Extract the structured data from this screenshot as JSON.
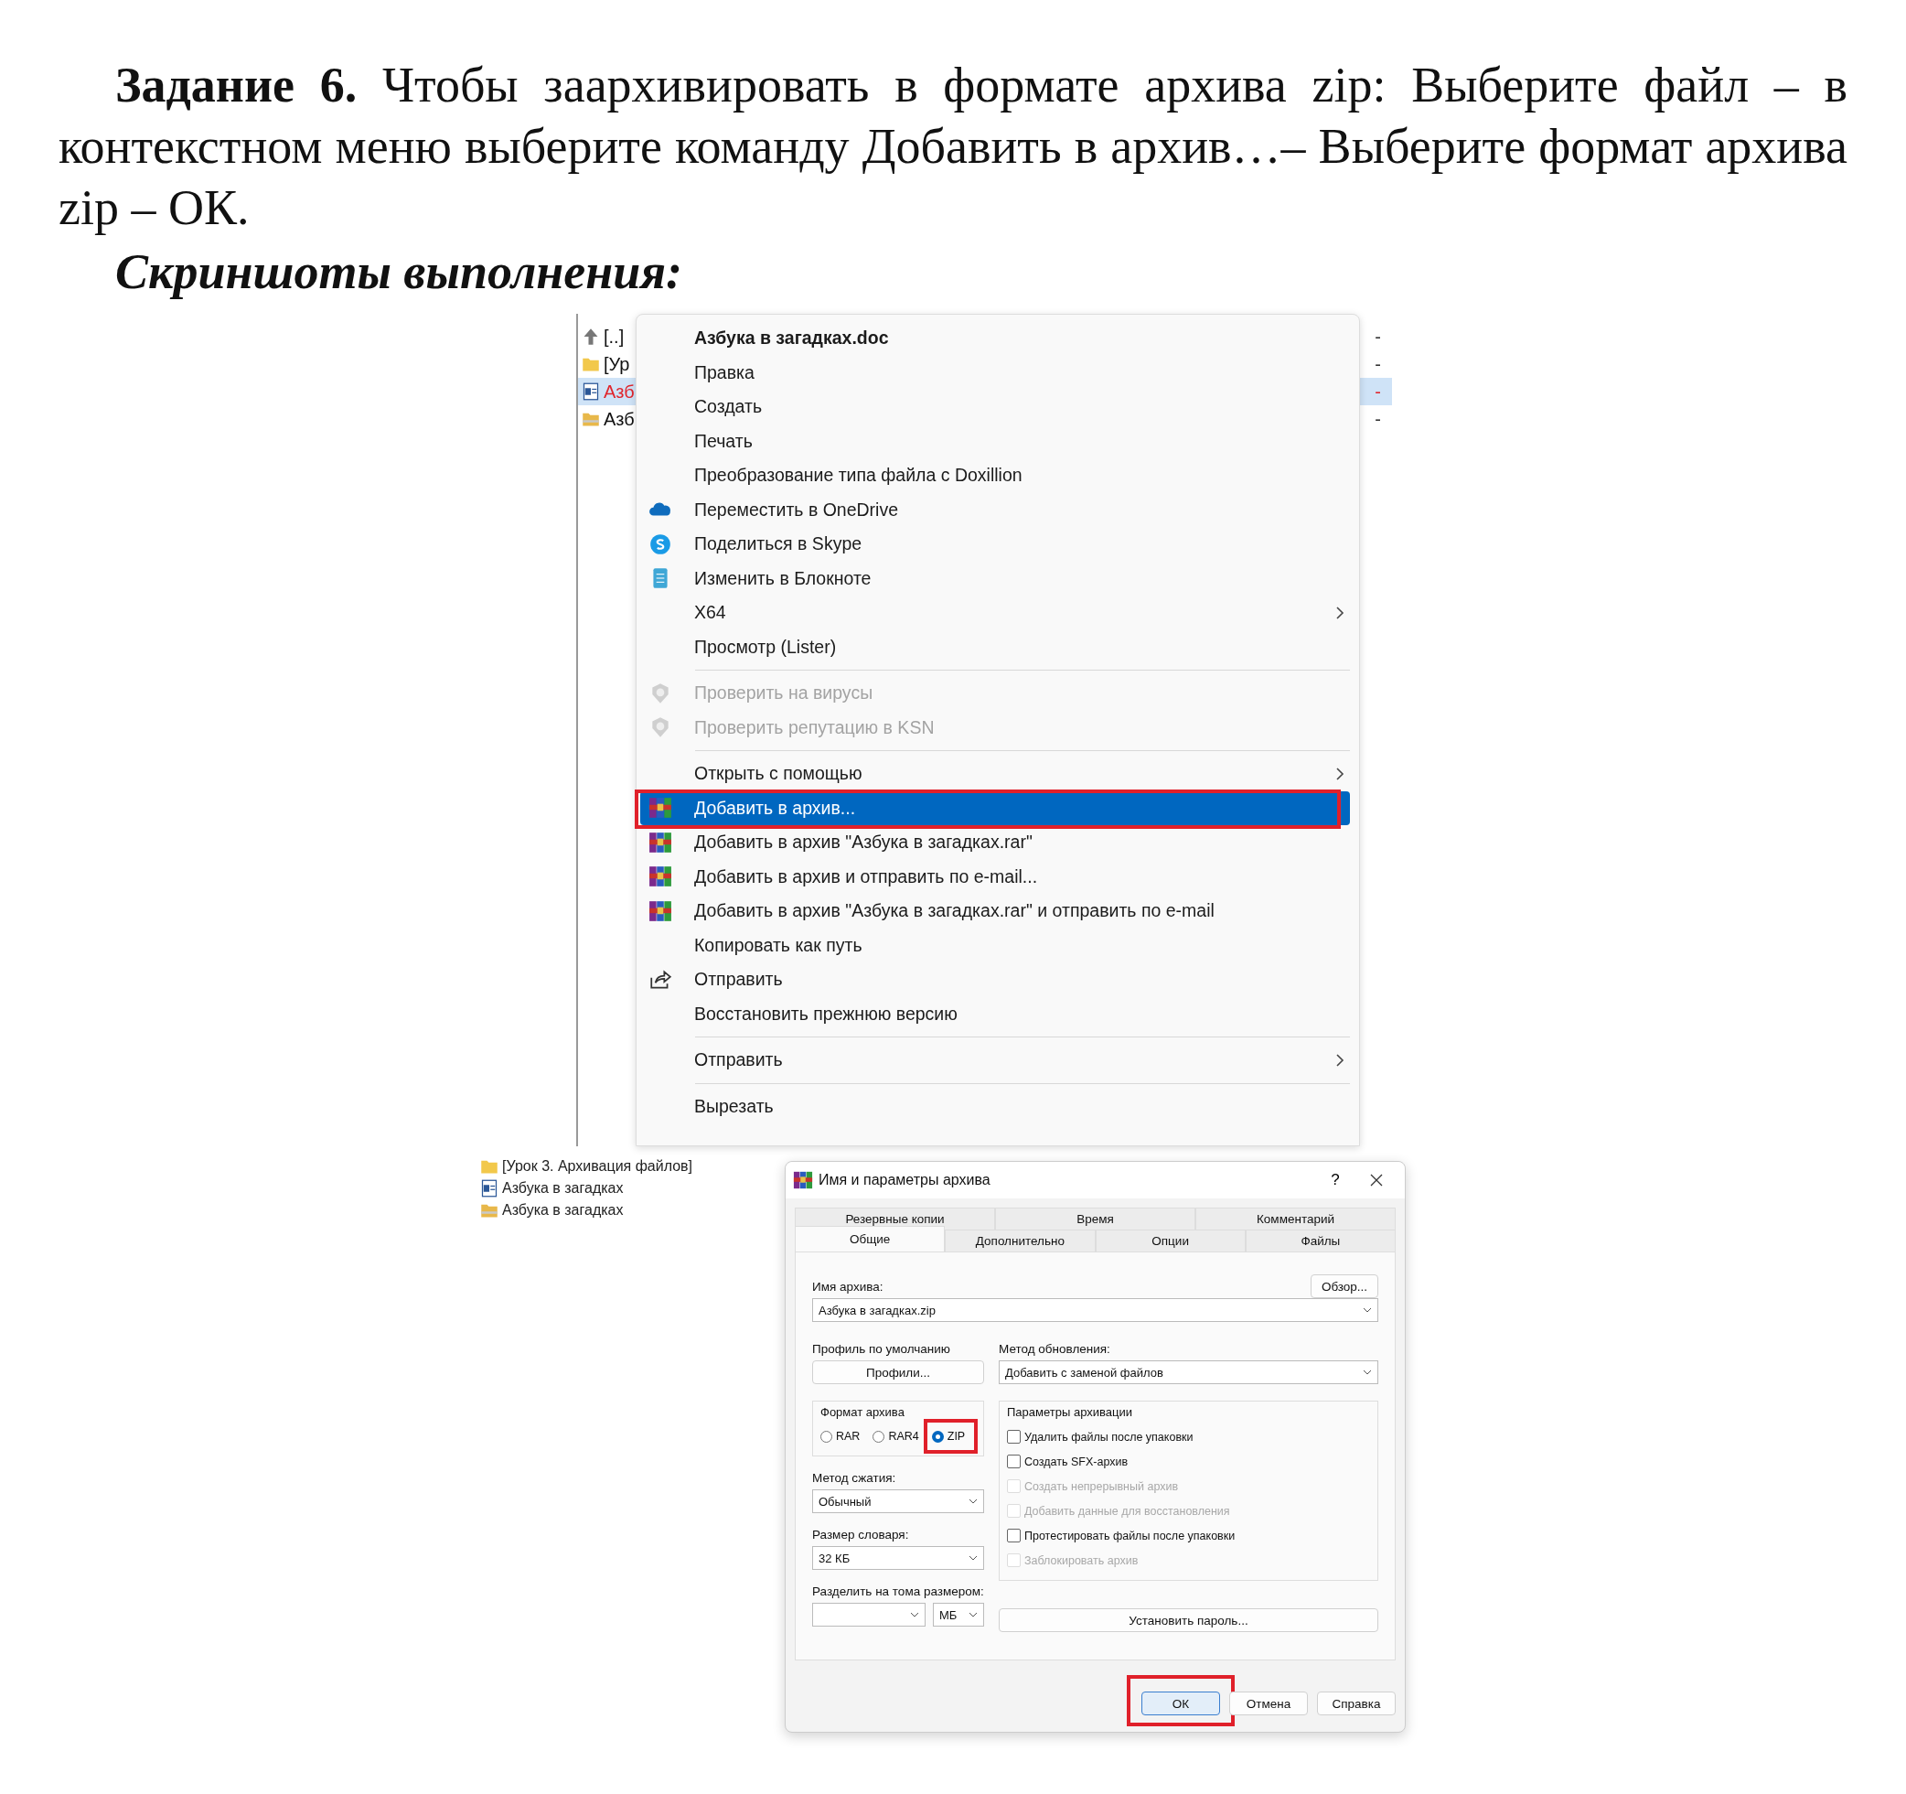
{
  "task": {
    "text": "**Задание 6.** Чтобы заархивировать в формате архива zip: Выберите файл – в контекстном меню выберите команду Добавить в архив…– Выберите формат архива zip – ОК."
  },
  "subtitle": "Скриншоты выполнения:",
  "screenshot_1": {
    "file_rows": [
      {
        "name": "[..]",
        "column_2": "-",
        "selected": false
      },
      {
        "name": "[Ур",
        "column_2": "-",
        "selected": false
      },
      {
        "name": "Азб",
        "column_2": "-",
        "selected": true
      },
      {
        "name": "Азб",
        "column_2": "-",
        "selected": false
      }
    ],
    "context_menu": {
      "groups": [
        {
          "items": [
            {
              "label": "Азбука в загадках.doc",
              "kind": "title",
              "disabled": false,
              "selected": false,
              "submenu": false
            },
            {
              "label": "Правка",
              "kind": "item",
              "disabled": false,
              "selected": false,
              "submenu": false
            },
            {
              "label": "Создать",
              "kind": "item",
              "disabled": false,
              "selected": false,
              "submenu": false
            },
            {
              "label": "Печать",
              "kind": "item",
              "disabled": false,
              "selected": false,
              "submenu": false
            },
            {
              "label": "Преобразование типа файла с Doxillion",
              "kind": "item",
              "disabled": false,
              "selected": false,
              "submenu": false
            },
            {
              "label": "Переместить в OneDrive",
              "kind": "item",
              "disabled": false,
              "selected": false,
              "submenu": false
            },
            {
              "label": "Поделиться в Skype",
              "kind": "item",
              "disabled": false,
              "selected": false,
              "submenu": false
            },
            {
              "label": "Изменить в Блокноте",
              "kind": "item",
              "disabled": false,
              "selected": false,
              "submenu": false
            },
            {
              "label": "X64",
              "kind": "item",
              "disabled": false,
              "selected": false,
              "submenu": true
            },
            {
              "label": "Просмотр (Lister)",
              "kind": "item",
              "disabled": false,
              "selected": false,
              "submenu": false
            }
          ]
        },
        {
          "items": [
            {
              "label": "Проверить на вирусы",
              "kind": "item",
              "disabled": true,
              "selected": false,
              "submenu": false
            },
            {
              "label": "Проверить репутацию в KSN",
              "kind": "item",
              "disabled": true,
              "selected": false,
              "submenu": false
            }
          ]
        },
        {
          "items": [
            {
              "label": "Открыть с помощью",
              "kind": "item",
              "disabled": false,
              "selected": false,
              "submenu": true
            },
            {
              "label": "Добавить в архив...",
              "kind": "item",
              "disabled": false,
              "selected": true,
              "submenu": false
            },
            {
              "label": "Добавить в архив \"Азбука в загадках.rar\"",
              "kind": "item",
              "disabled": false,
              "selected": false,
              "submenu": false
            },
            {
              "label": "Добавить в архив и отправить по e-mail...",
              "kind": "item",
              "disabled": false,
              "selected": false,
              "submenu": false
            },
            {
              "label": "Добавить в архив \"Азбука в загадках.rar\" и отправить по e-mail",
              "kind": "item",
              "disabled": false,
              "selected": false,
              "submenu": false
            },
            {
              "label": "Копировать как путь",
              "kind": "item",
              "disabled": false,
              "selected": false,
              "submenu": false
            },
            {
              "label": "Отправить",
              "kind": "item",
              "disabled": false,
              "selected": false,
              "submenu": false
            },
            {
              "label": "Восстановить прежнюю версию",
              "kind": "item",
              "disabled": false,
              "selected": false,
              "submenu": false
            }
          ]
        },
        {
          "items": [
            {
              "label": "Отправить",
              "kind": "item",
              "disabled": false,
              "selected": false,
              "submenu": true
            }
          ]
        },
        {
          "items": [
            {
              "label": "Вырезать",
              "kind": "item",
              "disabled": false,
              "selected": false,
              "submenu": false
            }
          ]
        }
      ]
    }
  },
  "screenshot_2": {
    "file_rows": [
      {
        "name": "[Урок 3. Архивация файлов]"
      },
      {
        "name": "Азбука в загадках"
      },
      {
        "name": "Азбука в загадках"
      }
    ],
    "dialog": {
      "title": "Имя и параметры архива",
      "help": "?",
      "tab_rows": [
        [
          {
            "label": "Резервные копии",
            "selected": false
          },
          {
            "label": "Время",
            "selected": false
          },
          {
            "label": "Комментарий",
            "selected": false
          }
        ],
        [
          {
            "label": "Общие",
            "selected": true
          },
          {
            "label": "Дополнительно",
            "selected": false
          },
          {
            "label": "Опции",
            "selected": false
          },
          {
            "label": "Файлы",
            "selected": false
          }
        ]
      ],
      "archive_name": {
        "label": "Имя архива:",
        "browse": "Обзор...",
        "value": "Азбука в загадках.zip"
      },
      "profile": {
        "label": "Профиль по умолчанию",
        "button": "Профили..."
      },
      "update_method": {
        "label": "Метод обновления:",
        "value": "Добавить с заменой файлов"
      },
      "format": {
        "label": "Формат архива",
        "options": [
          {
            "label": "RAR",
            "selected": false
          },
          {
            "label": "RAR4",
            "selected": false
          },
          {
            "label": "ZIP",
            "selected": true
          }
        ]
      },
      "compression": {
        "label": "Метод сжатия:",
        "value": "Обычный"
      },
      "dictionary": {
        "label": "Размер словаря:",
        "value": "32 КБ"
      },
      "split": {
        "label": "Разделить на тома размером:",
        "unit": "МБ"
      },
      "options": {
        "label": "Параметры архивации",
        "items": [
          {
            "label": "Удалить файлы после упаковки",
            "checked": false,
            "disabled": false
          },
          {
            "label": "Создать SFX-архив",
            "checked": false,
            "disabled": false
          },
          {
            "label": "Создать непрерывный архив",
            "checked": false,
            "disabled": true
          },
          {
            "label": "Добавить данные для восстановления",
            "checked": false,
            "disabled": true
          },
          {
            "label": "Протестировать файлы после упаковки",
            "checked": false,
            "disabled": false
          },
          {
            "label": "Заблокировать архив",
            "checked": false,
            "disabled": true
          }
        ]
      },
      "password_button": "Установить пароль...",
      "buttons": [
        {
          "label": "ОК",
          "default": true
        },
        {
          "label": "Отмена",
          "default": false
        },
        {
          "label": "Справка",
          "default": false
        }
      ]
    }
  }
}
